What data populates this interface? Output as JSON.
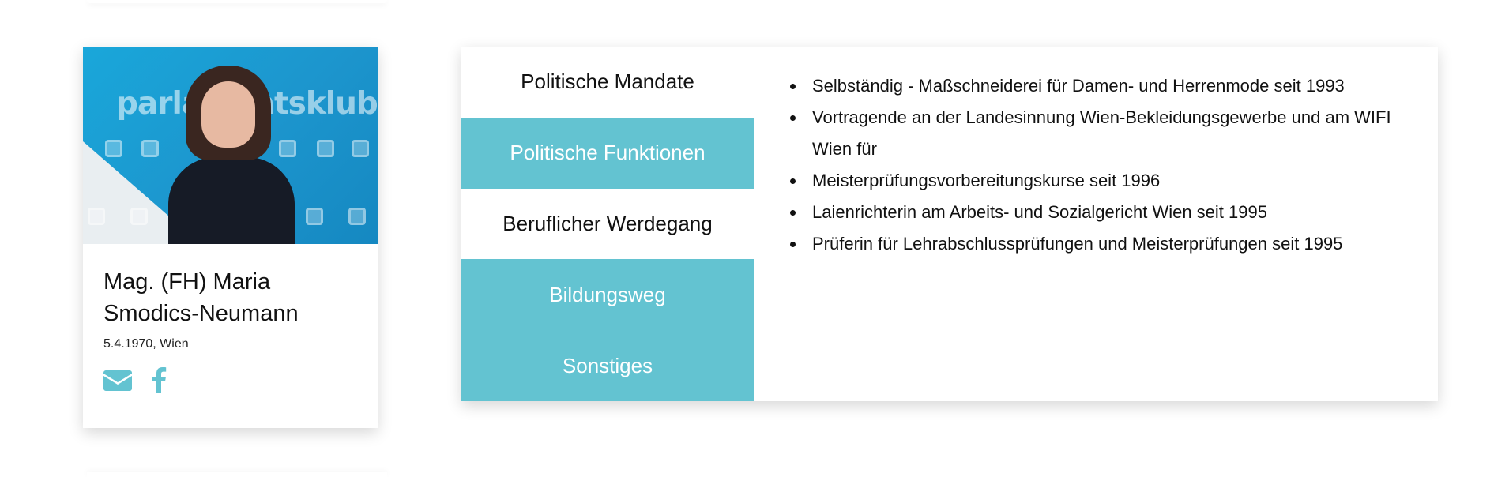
{
  "profile": {
    "photo_brand_text": "parlamentsklub",
    "name": "Mag. (FH) Maria Smodics-Neumann",
    "birth_info": "5.4.1970, Wien",
    "social": [
      {
        "icon": "mail-icon",
        "label": "E-Mail"
      },
      {
        "icon": "facebook-icon",
        "label": "Facebook"
      }
    ]
  },
  "tabs": [
    {
      "label": "Politische Mandate",
      "active": false,
      "style": "white"
    },
    {
      "label": "Politische Funktionen",
      "active": false,
      "style": "teal"
    },
    {
      "label": "Beruflicher Werdegang",
      "active": true,
      "style": "white"
    },
    {
      "label": "Bildungsweg",
      "active": false,
      "style": "teal"
    },
    {
      "label": "Sonstiges",
      "active": false,
      "style": "teal"
    }
  ],
  "content": {
    "items": [
      "Selbständig - Maßschneiderei für Damen- und Herrenmode seit 1993",
      "Vortragende an der Landesinnung Wien-Bekleidungsgewerbe und am WIFI Wien für",
      "Meisterprüfungsvorbereitungskurse seit 1996",
      "Laienrichterin am Arbeits- und Sozialgericht Wien seit 1995",
      "Prüferin für Lehrabschlussprüfungen und Meisterprüfungen seit 1995"
    ]
  },
  "colors": {
    "accent": "#63c3d1",
    "photo_background": "#1aa7da",
    "text": "#111111"
  }
}
